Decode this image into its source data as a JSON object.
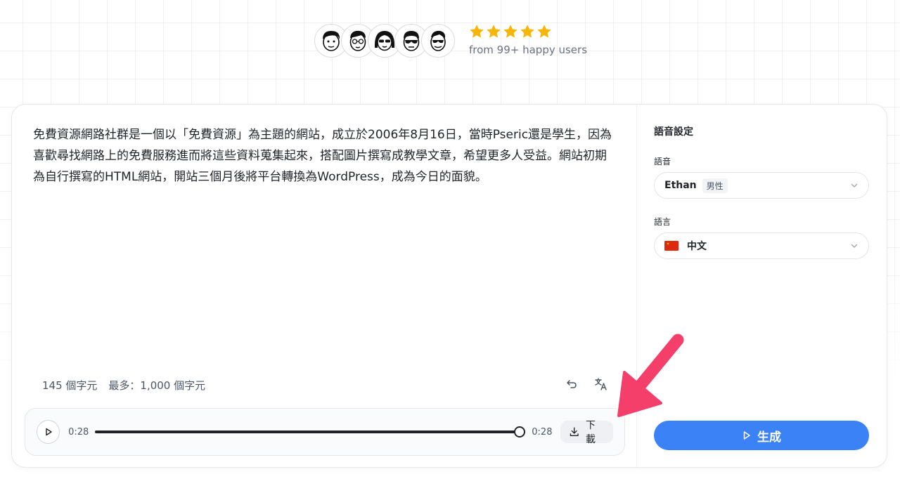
{
  "social_proof": {
    "rating_stars": 5,
    "text": "from 99+ happy users",
    "star_color": "#f5b70b",
    "avatars": [
      "avatar-face-1",
      "avatar-face-2",
      "avatar-face-3",
      "avatar-face-4",
      "avatar-face-5"
    ]
  },
  "editor": {
    "text": "免費資源網路社群是一個以「免費資源」為主題的網站，成立於2006年8月16日，當時Pseric還是學生，因為喜歡尋找網路上的免費服務進而將這些資料蒐集起來，搭配圖片撰寫成教學文章，希望更多人受益。網站初期為自行撰寫的HTML網站，開站三個月後將平台轉換為WordPress，成為今日的面貌。",
    "char_count": "145 個字元",
    "max_chars": "最多：1,000 個字元"
  },
  "player": {
    "current_time": "0:28",
    "duration": "0:28",
    "progress": 1.0,
    "download_label": "下載"
  },
  "settings": {
    "title": "語音設定",
    "voice_label": "語音",
    "voice_name": "Ethan",
    "voice_gender": "男性",
    "language_label": "語言",
    "language_name": "中文",
    "generate_label": "生成"
  },
  "colors": {
    "accent": "#3b82f6",
    "annotation_arrow": "#f43f6b"
  }
}
